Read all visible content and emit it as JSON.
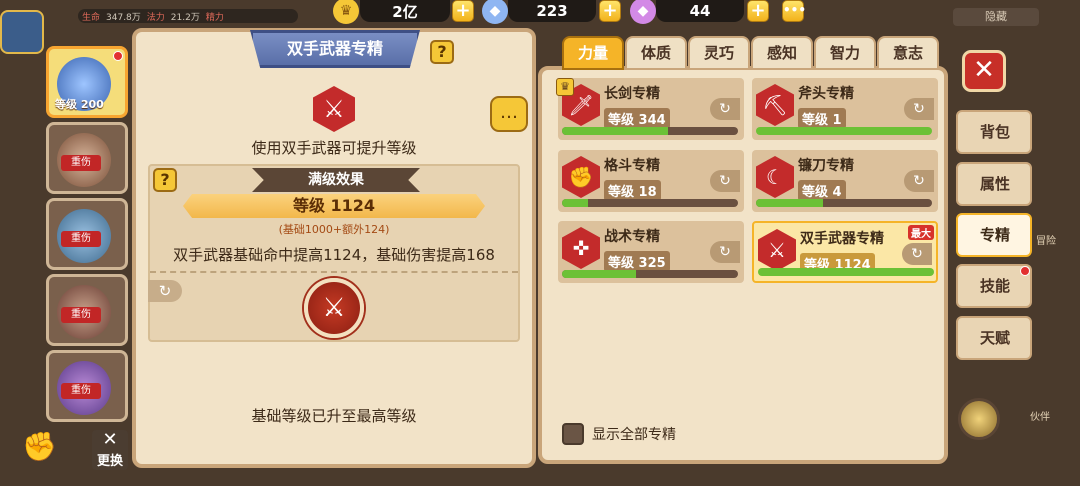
{
  "topbar": {
    "stats": [
      {
        "label": "生命",
        "value": "347.8万"
      },
      {
        "label": "法力",
        "value": "21.2万"
      },
      {
        "label": "精力",
        "value": ""
      }
    ],
    "gold": "2亿",
    "diamond": "223",
    "gem": "44",
    "right_label": "隐藏"
  },
  "heroes": [
    {
      "level_label": "等级 200",
      "status": ""
    },
    {
      "level_label": "",
      "status": "重伤"
    },
    {
      "level_label": "",
      "status": "重伤"
    },
    {
      "level_label": "",
      "status": "重伤"
    },
    {
      "level_label": "",
      "status": "重伤"
    }
  ],
  "swap_label": "更换",
  "detail": {
    "title": "双手武器专精",
    "description": "使用双手武器可提升等级",
    "effect_ribbon": "满级效果",
    "level": "等级 1124",
    "level_sub": "(基础1000+额外124)",
    "effect_text": "双手武器基础命中提高1124，基础伤害提高168",
    "footer": "基础等级已升至最高等级"
  },
  "tabs": [
    {
      "label": "力量",
      "active": true
    },
    {
      "label": "体质",
      "active": false
    },
    {
      "label": "灵巧",
      "active": false
    },
    {
      "label": "感知",
      "active": false
    },
    {
      "label": "智力",
      "active": false
    },
    {
      "label": "意志",
      "active": false
    }
  ],
  "skills": [
    {
      "name": "长剑专精",
      "level": "等级 344",
      "progress": 0.6,
      "icon": "sword-icon",
      "selected": false,
      "max": false
    },
    {
      "name": "斧头专精",
      "level": "等级 1",
      "progress": 1.0,
      "icon": "axe-icon",
      "selected": false,
      "max": false
    },
    {
      "name": "格斗专精",
      "level": "等级 18",
      "progress": 0.15,
      "icon": "fist-icon",
      "selected": false,
      "max": false
    },
    {
      "name": "镰刀专精",
      "level": "等级 4",
      "progress": 0.38,
      "icon": "scythe-icon",
      "selected": false,
      "max": false
    },
    {
      "name": "战术专精",
      "level": "等级 325",
      "progress": 0.42,
      "icon": "tactics-icon",
      "selected": false,
      "max": false
    },
    {
      "name": "双手武器专精",
      "level": "等级 1124",
      "progress": 1.0,
      "icon": "crossed-swords-icon",
      "selected": true,
      "max": true
    }
  ],
  "max_badge": "最大",
  "show_all_label": "显示全部专精",
  "side_menu": [
    {
      "label": "背包",
      "active": false
    },
    {
      "label": "属性",
      "active": false
    },
    {
      "label": "专精",
      "active": true
    },
    {
      "label": "技能",
      "active": false
    },
    {
      "label": "天赋",
      "active": false
    }
  ],
  "far_right": [
    "冒险",
    "伙伴"
  ],
  "colors": {
    "accent": "#f5b428",
    "danger": "#c32b2b",
    "progress": "#6cc136",
    "parchment": "#f2e3c8"
  }
}
